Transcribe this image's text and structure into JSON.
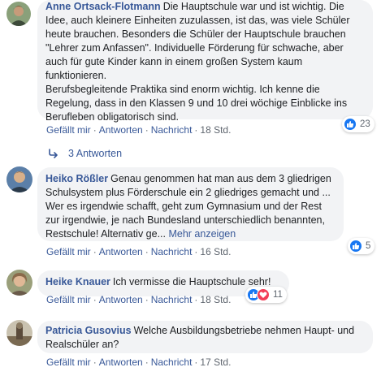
{
  "comments": [
    {
      "author": "Anne Ortsack-Flotmann",
      "text": "Die Hauptschule war und ist wichtig. Die Idee, auch kleinere Einheiten zuzulassen, ist das, was viele Schüler heute brauchen. Besonders die Schüler der Hauptschule brauchen \"Lehrer zum Anfassen\". Individuelle Förderung für schwache, aber auch für gute Kinder kann in einem großen System kaum funktionieren.",
      "text2": "Berufsbegleitende Praktika sind enorm wichtig. Ich kenne die Regelung, dass in den Klassen 9 und 10 drei wöchige Einblicke ins Berufleben obligatorisch sind.",
      "like_label": "Gefällt mir",
      "reply_label": "Antworten",
      "message_label": "Nachricht",
      "time": "18 Std.",
      "reaction_count": "23",
      "replies_label": "3 Antworten"
    },
    {
      "author": "Heiko Rößler",
      "text": "Genau genommen hat man aus dem 3 gliedrigen Schulsystem plus Förderschule ein 2 gliedriges gemacht und ... Wer es irgendwie schafft, geht zum Gymnasium und der Rest zur irgendwie, je nach Bundesland unterschiedlich benannten, Restschule! Alternativ ge...",
      "more_label": "Mehr anzeigen",
      "like_label": "Gefällt mir",
      "reply_label": "Antworten",
      "message_label": "Nachricht",
      "time": "16 Std.",
      "reaction_count": "5"
    },
    {
      "author": "Heike Knauer",
      "text": "Ich vermisse die Hauptschule sehr!",
      "like_label": "Gefällt mir",
      "reply_label": "Antworten",
      "message_label": "Nachricht",
      "time": "18 Std.",
      "reaction_count": "11"
    },
    {
      "author": "Patricia Gusovius",
      "text": "Welche Ausbildungsbetriebe nehmen Haupt- und Realschüler an?",
      "like_label": "Gefällt mir",
      "reply_label": "Antworten",
      "message_label": "Nachricht",
      "time": "17 Std."
    }
  ],
  "separator": "·",
  "colors": {
    "link": "#385898",
    "bubble": "#f2f3f5",
    "like": "#1877f2",
    "love": "#f33e58"
  }
}
